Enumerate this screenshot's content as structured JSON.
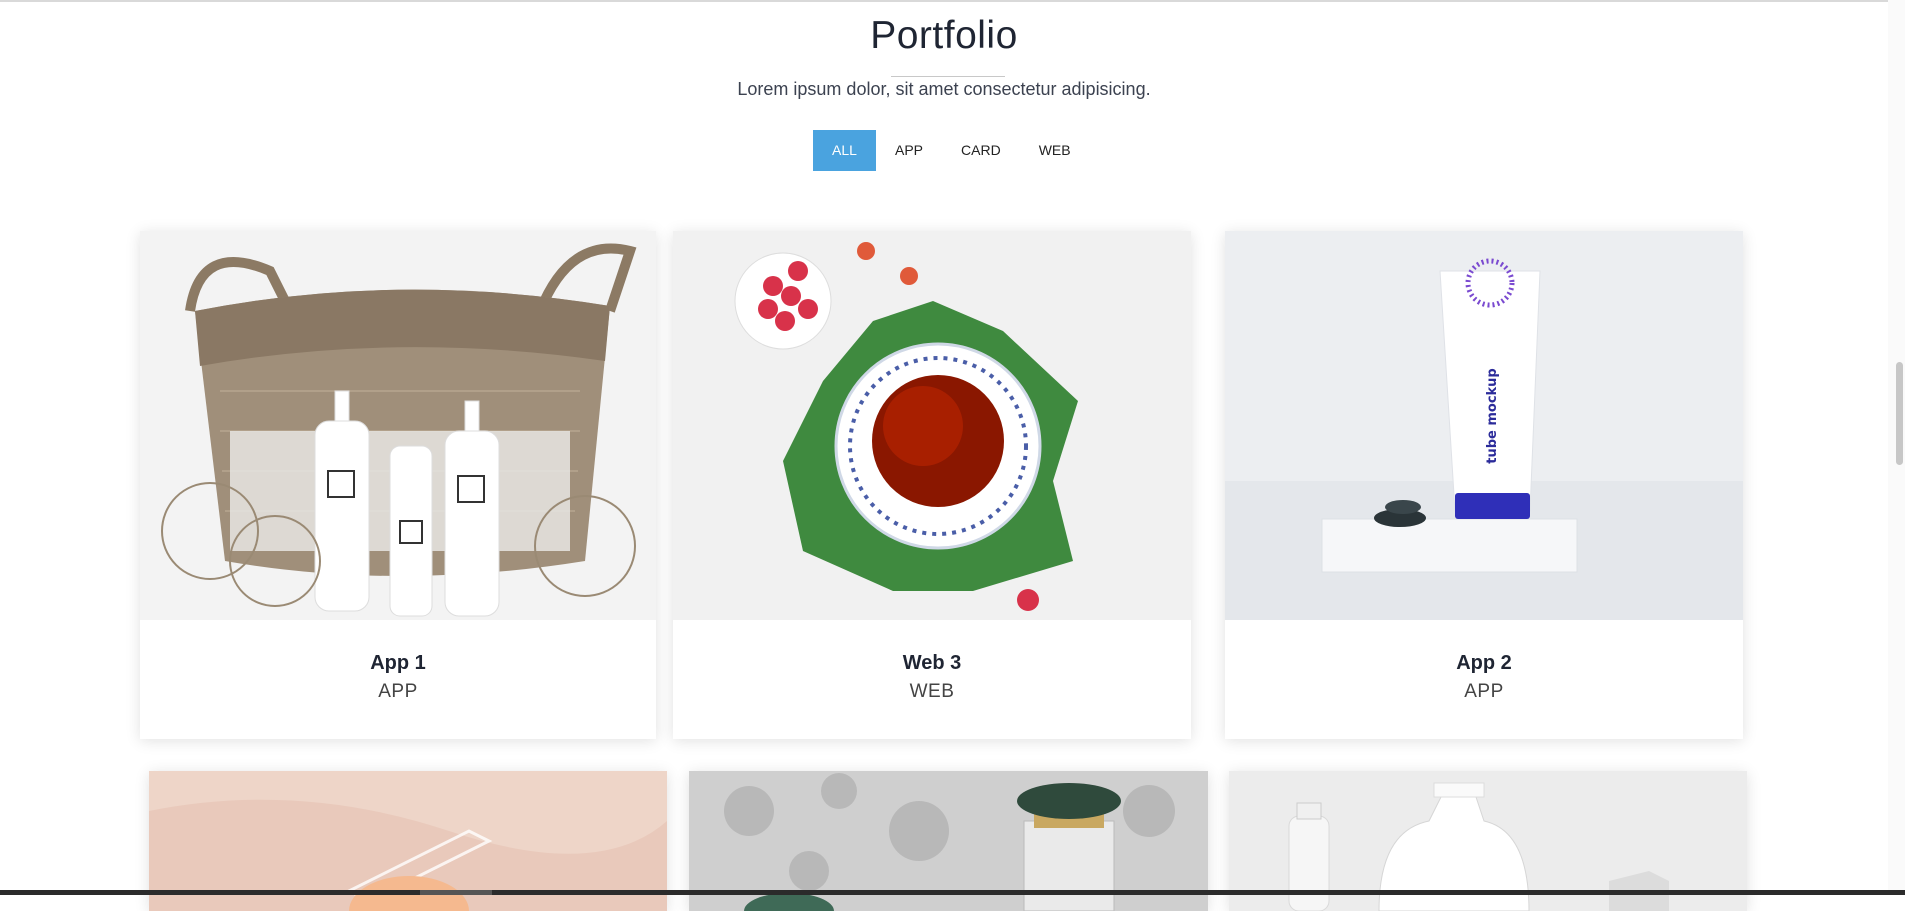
{
  "section": {
    "title": "Portfolio",
    "subtitle": "Lorem ipsum dolor, sit amet consectetur adipisicing."
  },
  "filters": [
    {
      "label": "ALL",
      "active": true
    },
    {
      "label": "APP",
      "active": false
    },
    {
      "label": "CARD",
      "active": false
    },
    {
      "label": "WEB",
      "active": false
    }
  ],
  "items": [
    {
      "title": "App 1",
      "category": "APP",
      "image": "basket-with-cosmetic-bottles-photo"
    },
    {
      "title": "Web 3",
      "category": "WEB",
      "image": "tea-cup-with-raspberries-photo"
    },
    {
      "title": "App 2",
      "category": "APP",
      "image": "tube-mockup-photo"
    },
    {
      "title": "",
      "category": "",
      "image": "pink-marble-with-glass-photo"
    },
    {
      "title": "",
      "category": "",
      "image": "perfume-bottle-on-marble-photo"
    },
    {
      "title": "",
      "category": "",
      "image": "white-bottles-photo"
    }
  ],
  "colors": {
    "accent": "#4aa3df",
    "title": "#1f2533"
  }
}
